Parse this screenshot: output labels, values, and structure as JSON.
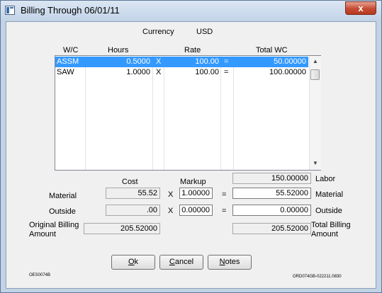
{
  "window": {
    "title": "Billing Through 06/01/11",
    "close_glyph": "x",
    "icon": "app-window-icon"
  },
  "currency": {
    "label": "Currency",
    "value": "USD"
  },
  "grid": {
    "headers": {
      "wc": "W/C",
      "hours": "Hours",
      "rate": "Rate",
      "total": "Total WC"
    },
    "rows": [
      {
        "wc": "ASSM",
        "hours": "0.5000",
        "x": "X",
        "rate": "100.00",
        "eq": "=",
        "total": "50.00000",
        "selected": true
      },
      {
        "wc": "SAW",
        "hours": "1.0000",
        "x": "X",
        "rate": "100.00",
        "eq": "=",
        "total": "100.00000",
        "selected": false
      }
    ],
    "scroll_up": "▲",
    "scroll_down": "▼"
  },
  "summary": {
    "labor_total": "150.00000",
    "labor_label": "Labor",
    "cost_header": "Cost",
    "markup_header": "Markup",
    "material": {
      "label": "Material",
      "cost": "55.52",
      "x": "X",
      "markup": "1.00000",
      "eq": "=",
      "result": "55.52000",
      "result_label": "Material"
    },
    "outside": {
      "label": "Outside",
      "cost": ".00",
      "x": "X",
      "markup": "0.00000",
      "eq": "=",
      "result": "0.00000",
      "result_label": "Outside"
    },
    "original_billing": {
      "label_line1": "Original Billing",
      "label_line2": "Amount",
      "value": "205.52000"
    },
    "total_billing": {
      "label_line1": "Total Billing",
      "label_line2": "Amount",
      "value": "205.52000"
    }
  },
  "buttons": {
    "ok": {
      "first": "O",
      "rest": "k"
    },
    "cancel": {
      "first": "C",
      "rest": "ancel"
    },
    "notes": {
      "first": "N",
      "rest": "otes"
    }
  },
  "footer": {
    "left_code": "OES0074B",
    "right_code": "ORD074GB-022211.0830"
  }
}
